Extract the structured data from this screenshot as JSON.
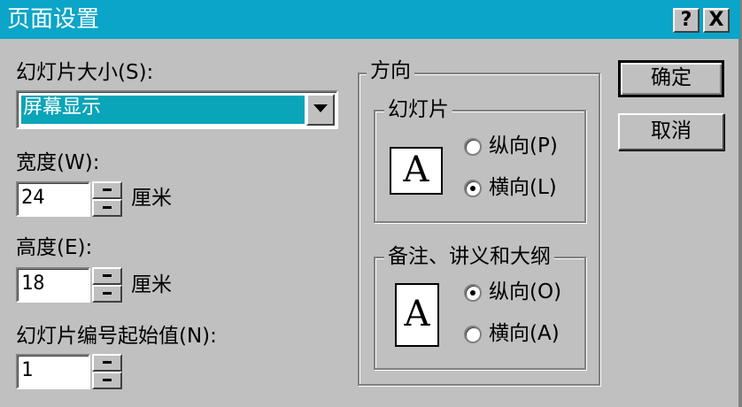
{
  "title": "页面设置",
  "title_buttons": {
    "help": "?",
    "close": "X"
  },
  "slide_size": {
    "label": "幻灯片大小(S):",
    "value": "屏幕显示"
  },
  "width": {
    "label": "宽度(W):",
    "value": "24",
    "unit": "厘米"
  },
  "height": {
    "label": "高度(E):",
    "value": "18",
    "unit": "厘米"
  },
  "numbering": {
    "label": "幻灯片编号起始值(N):",
    "value": "1"
  },
  "orientation": {
    "group_label": "方向",
    "slides": {
      "label": "幻灯片",
      "icon_letter": "A",
      "options": [
        "纵向(P)",
        "横向(L)"
      ],
      "selected": "横向(L)"
    },
    "notes": {
      "label": "备注、讲义和大纲",
      "icon_letter": "A",
      "options": [
        "纵向(O)",
        "横向(A)"
      ],
      "selected": "纵向(O)"
    }
  },
  "buttons": {
    "ok": "确定",
    "cancel": "取消"
  }
}
